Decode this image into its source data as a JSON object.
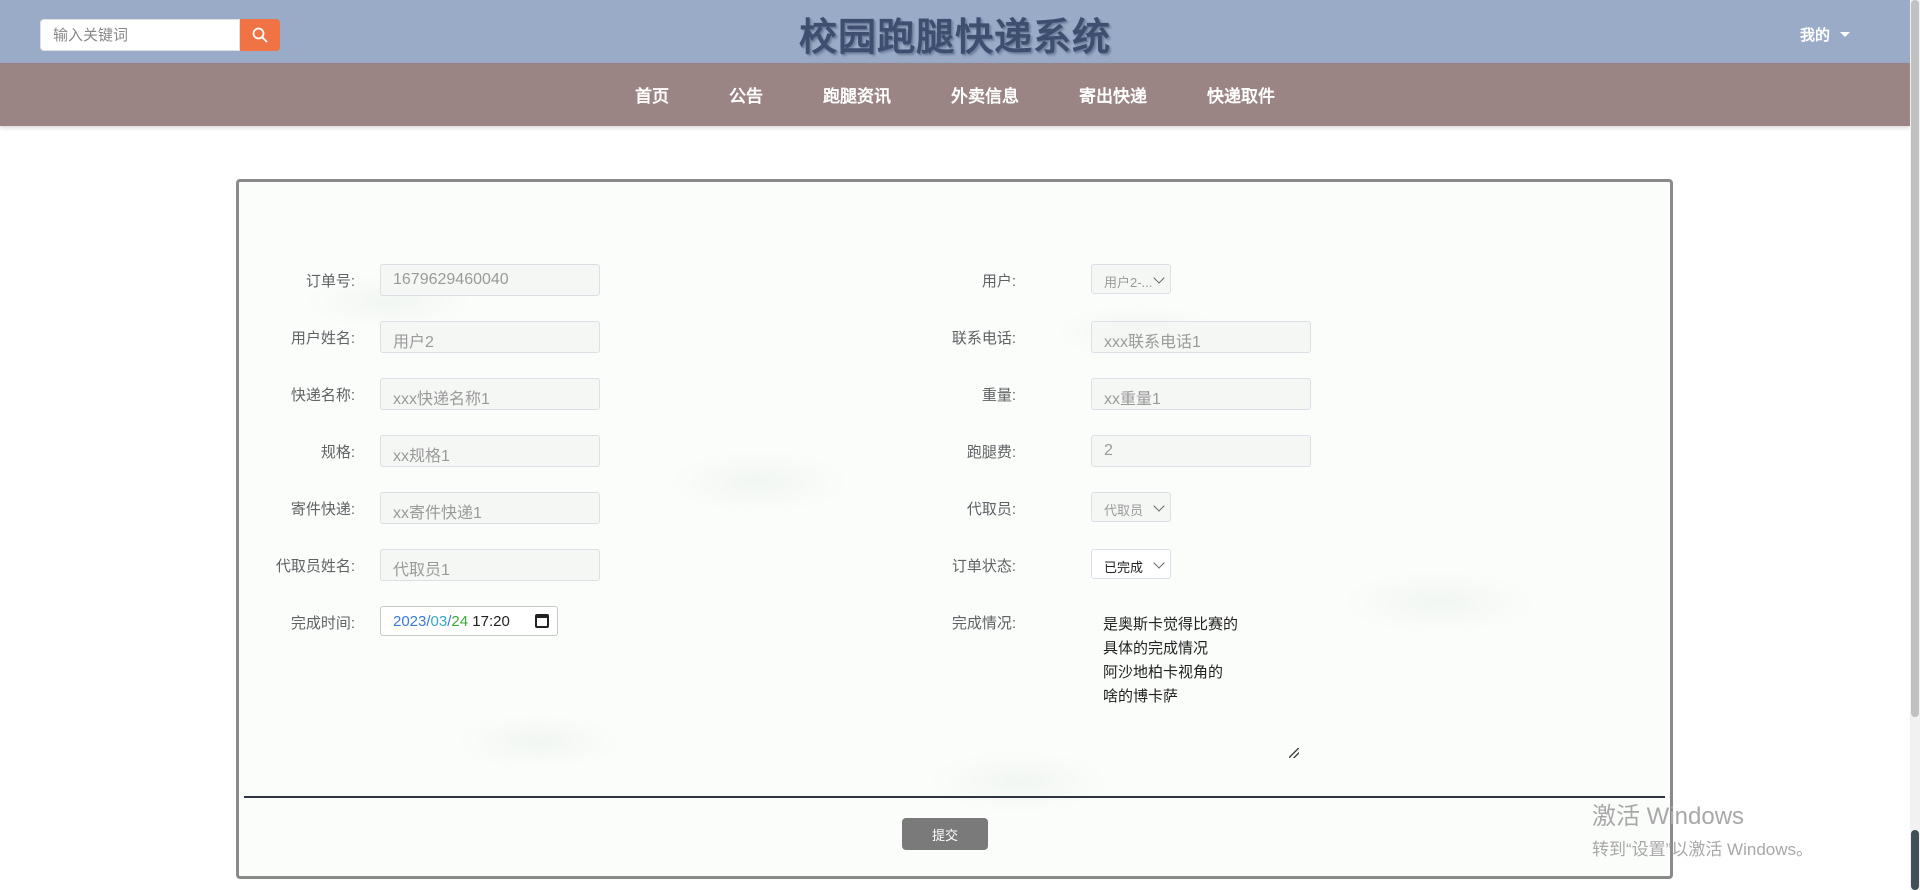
{
  "header": {
    "search_placeholder": "输入关键词",
    "title": "校园跑腿快递系统",
    "user_menu": "我的"
  },
  "nav": {
    "items": [
      "首页",
      "公告",
      "跑腿资讯",
      "外卖信息",
      "寄出快递",
      "快递取件"
    ]
  },
  "form": {
    "order_no": {
      "label": "订单号:",
      "value": "1679629460040"
    },
    "user": {
      "label": "用户:",
      "value": "用户2-..."
    },
    "user_name": {
      "label": "用户姓名:",
      "value": "用户2"
    },
    "phone": {
      "label": "联系电话:",
      "value": "xxx联系电话1"
    },
    "express_name": {
      "label": "快递名称:",
      "value": "xxx快递名称1"
    },
    "weight": {
      "label": "重量:",
      "value": "xx重量1"
    },
    "spec": {
      "label": "规格:",
      "value": "xx规格1"
    },
    "fee": {
      "label": "跑腿费:",
      "value": "2"
    },
    "send_express": {
      "label": "寄件快递:",
      "value": "xx寄件快递1"
    },
    "courier": {
      "label": "代取员:",
      "value": "代取员"
    },
    "courier_name": {
      "label": "代取员姓名:",
      "value": "代取员1"
    },
    "order_status": {
      "label": "订单状态:",
      "value": "已完成"
    },
    "finish_time": {
      "label": "完成时间:",
      "year": "2023",
      "month": "03",
      "day": "24",
      "time": "17:20"
    },
    "finish_desc": {
      "label": "完成情况:",
      "lines": [
        "是奥斯卡觉得比赛的",
        "具体的完成情况",
        "阿沙地柏卡视角的",
        "啥的博卡萨"
      ]
    },
    "submit_label": "提交"
  },
  "watermark": {
    "line1": "激活 Windows",
    "line2": "转到“设置”以激活 Windows。"
  },
  "colors": {
    "header_bg": "#9aabc8",
    "nav_bg": "#9a8484",
    "search_button": "#f07346",
    "submit_button": "#7a7a7a"
  }
}
